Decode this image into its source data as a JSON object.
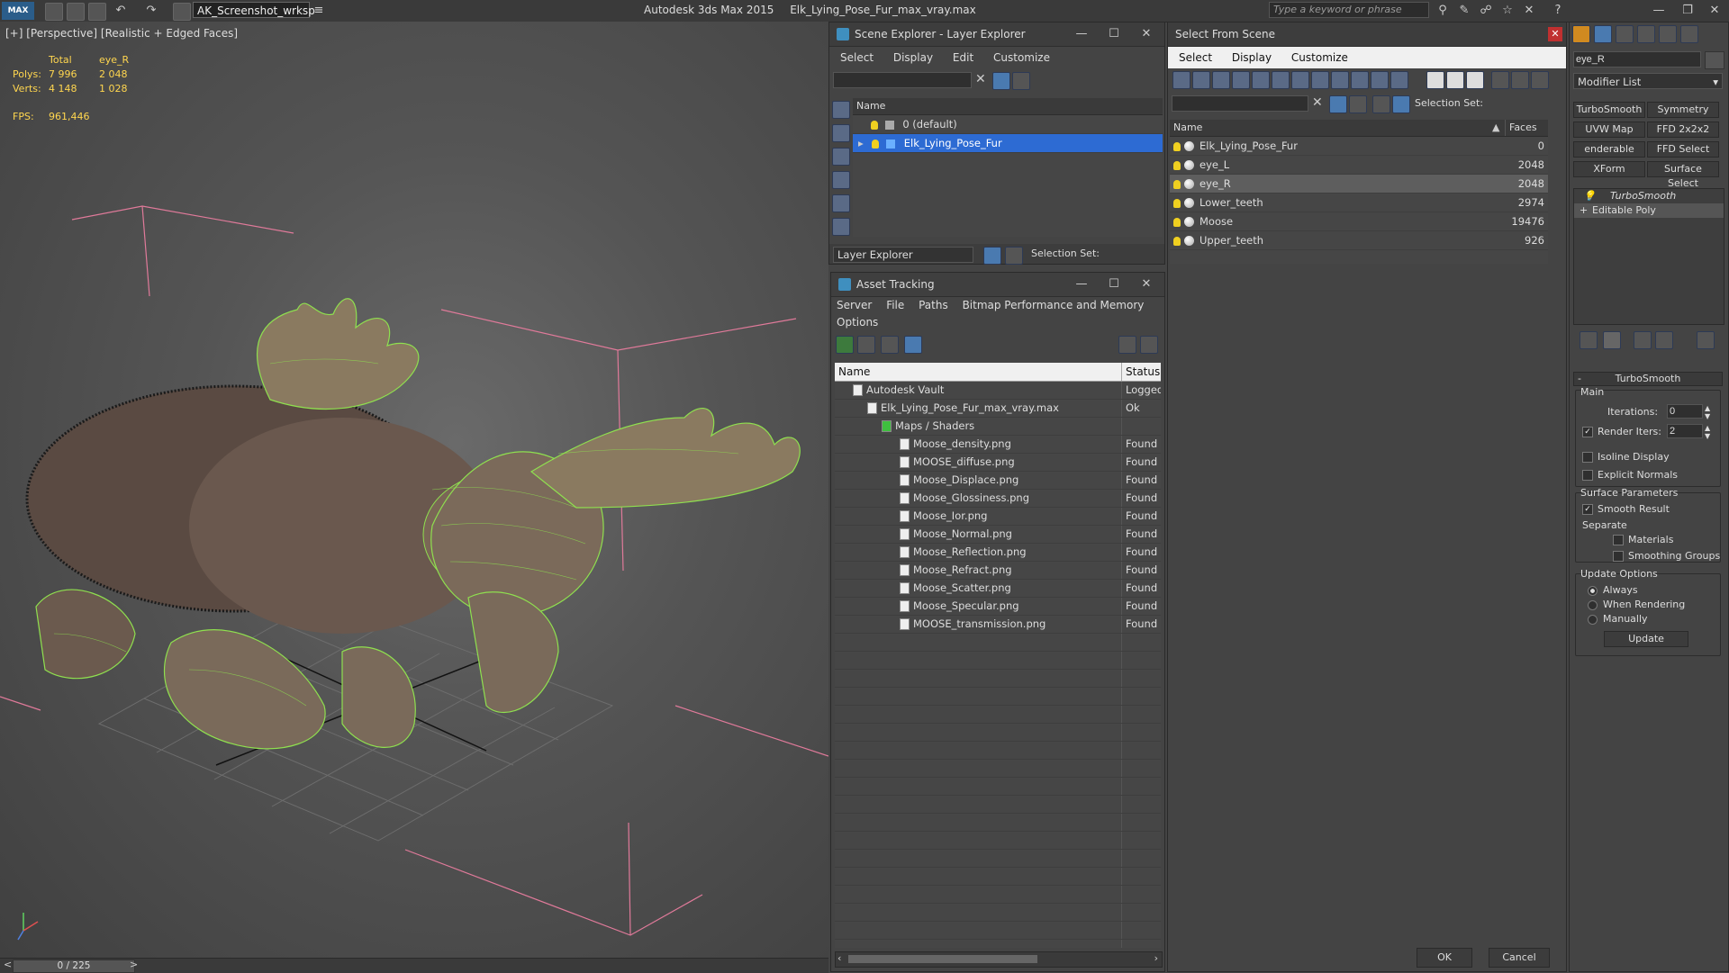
{
  "titlebar": {
    "logo": "MAX",
    "workspace": "AK_Screenshot_wrksp",
    "app_name": "Autodesk 3ds Max  2015",
    "file_name": "Elk_Lying_Pose_Fur_max_vray.max",
    "search_placeholder": "Type a keyword or phrase"
  },
  "viewport": {
    "label": "[+] [Perspective] [Realistic + Edged Faces]",
    "stats": {
      "col_total": "Total",
      "col_selected": "eye_R",
      "polys_label": "Polys:",
      "polys_total": "7 996",
      "polys_sel": "2 048",
      "verts_label": "Verts:",
      "verts_total": "4 148",
      "verts_sel": "1 028",
      "fps_label": "FPS:",
      "fps_value": "961,446"
    }
  },
  "scene_explorer": {
    "title": "Scene Explorer - Layer Explorer",
    "menu": [
      "Select",
      "Display",
      "Edit",
      "Customize"
    ],
    "col_name": "Name",
    "layers": [
      {
        "name": "0 (default)"
      },
      {
        "name": "Elk_Lying_Pose_Fur"
      }
    ],
    "footer_mode": "Layer Explorer",
    "footer_selset": "Selection Set:"
  },
  "asset_tracking": {
    "title": "Asset Tracking",
    "menu": [
      "Server",
      "File",
      "Paths",
      "Bitmap Performance and Memory",
      "Options"
    ],
    "col_name": "Name",
    "col_status": "Status",
    "rows": [
      {
        "name": "Autodesk Vault",
        "status": "Logged"
      },
      {
        "name": "Elk_Lying_Pose_Fur_max_vray.max",
        "status": "Ok"
      },
      {
        "name": "Maps / Shaders",
        "status": ""
      },
      {
        "name": "Moose_density.png",
        "status": "Found"
      },
      {
        "name": "MOOSE_diffuse.png",
        "status": "Found"
      },
      {
        "name": "Moose_Displace.png",
        "status": "Found"
      },
      {
        "name": "Moose_Glossiness.png",
        "status": "Found"
      },
      {
        "name": "Moose_Ior.png",
        "status": "Found"
      },
      {
        "name": "Moose_Normal.png",
        "status": "Found"
      },
      {
        "name": "Moose_Reflection.png",
        "status": "Found"
      },
      {
        "name": "Moose_Refract.png",
        "status": "Found"
      },
      {
        "name": "Moose_Scatter.png",
        "status": "Found"
      },
      {
        "name": "Moose_Specular.png",
        "status": "Found"
      },
      {
        "name": "MOOSE_transmission.png",
        "status": "Found"
      }
    ]
  },
  "select_from_scene": {
    "title": "Select From Scene",
    "menu": [
      "Select",
      "Display",
      "Customize"
    ],
    "selset": "Selection Set:",
    "col_name": "Name",
    "col_faces": "Faces",
    "rows": [
      {
        "name": "Elk_Lying_Pose_Fur",
        "faces": "0"
      },
      {
        "name": "eye_L",
        "faces": "2048"
      },
      {
        "name": "eye_R",
        "faces": "2048"
      },
      {
        "name": "Lower_teeth",
        "faces": "2974"
      },
      {
        "name": "Moose",
        "faces": "19476"
      },
      {
        "name": "Upper_teeth",
        "faces": "926"
      }
    ],
    "ok": "OK",
    "cancel": "Cancel"
  },
  "command_panel": {
    "object_name": "eye_R",
    "modifier_list": "Modifier List",
    "buttons": [
      "TurboSmooth",
      "Symmetry",
      "UVW Map",
      "FFD 2x2x2",
      "enderable Splir",
      "FFD Select",
      "XForm",
      "Surface Select"
    ],
    "stack": [
      "TurboSmooth",
      "Editable Poly"
    ],
    "rollout_title": "TurboSmooth",
    "main_label": "Main",
    "iterations_label": "Iterations:",
    "iterations_value": "0",
    "render_iters_label": "Render Iters:",
    "render_iters_value": "2",
    "isoline": "Isoline Display",
    "explicit_normals": "Explicit Normals",
    "surface_params": "Surface Parameters",
    "smooth_result": "Smooth Result",
    "separate": "Separate",
    "materials": "Materials",
    "smoothing_groups": "Smoothing Groups",
    "update_options": "Update Options",
    "always": "Always",
    "when_rendering": "When Rendering",
    "manually": "Manually",
    "update": "Update"
  },
  "statusbar": {
    "frame": "0 / 225"
  }
}
